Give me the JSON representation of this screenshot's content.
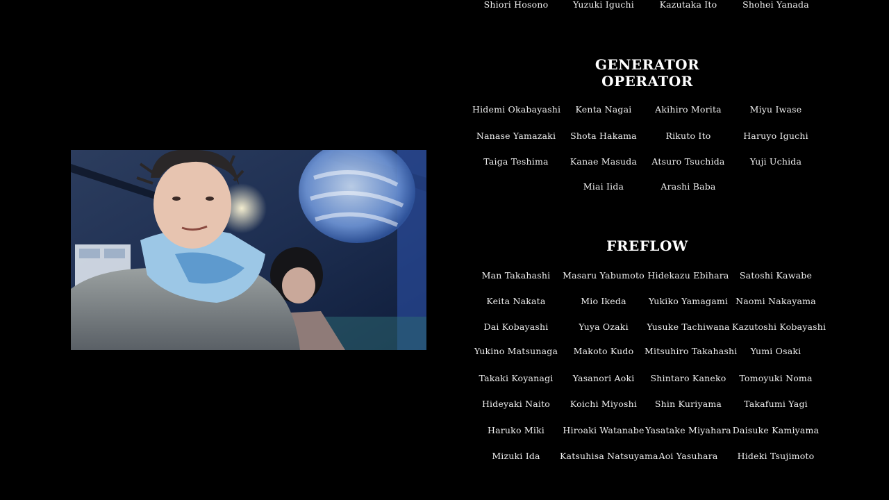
{
  "top_row": [
    "Shiori Hosono",
    "Yuzuki Iguchi",
    "Kazutaka Ito",
    "Shohei Yanada"
  ],
  "sections": [
    {
      "title_line1": "GENERATOR",
      "title_line2": "OPERATOR",
      "rows": [
        [
          "Hidemi Okabayashi",
          "Kenta Nagai",
          "Akihiro Morita",
          "Miyu Iwase"
        ],
        [
          "Nanase Yamazaki",
          "Shota Hakama",
          "Rikuto Ito",
          "Haruyo Iguchi"
        ],
        [
          "Taiga Teshima",
          "Kanae Masuda",
          "Atsuro Tsuchida",
          "Yuji Uchida"
        ],
        [
          "Miai Iida",
          "Arashi Baba"
        ]
      ]
    },
    {
      "title_line1": "FREFLOW",
      "rows": [
        [
          "Man Takahashi",
          "Masaru Yabumoto",
          "Hidekazu Ebihara",
          "Satoshi Kawabe"
        ],
        [
          "Keita Nakata",
          "Mio Ikeda",
          "Yukiko Yamagami",
          "Naomi Nakayama"
        ],
        [
          "Dai Kobayashi",
          "Yuya Ozaki",
          "Yusuke Tachiwana",
          "Kazutoshi Kobayashi"
        ],
        [
          "Yukino Matsunaga",
          "Makoto Kudo",
          "Mitsuhiro Takahashi",
          "Yumi Osaki"
        ],
        [
          "Takaki Koyanagi",
          "Yasanori Aoki",
          "Shintaro Kaneko",
          "Tomoyuki Noma"
        ],
        [
          "Hideyaki Naito",
          "Koichi Miyoshi",
          "Shin Kuriyama",
          "Takafumi Yagi"
        ],
        [
          "Haruko Miki",
          "Hiroaki Watanabe",
          "Yasatake Miyahara",
          "Daisuke Kamiyama"
        ],
        [
          "Mizuki Ida",
          "Katsuhisa Natsuyama",
          "Aoi Yasuhara",
          "Hideki Tsujimoto"
        ]
      ]
    }
  ]
}
